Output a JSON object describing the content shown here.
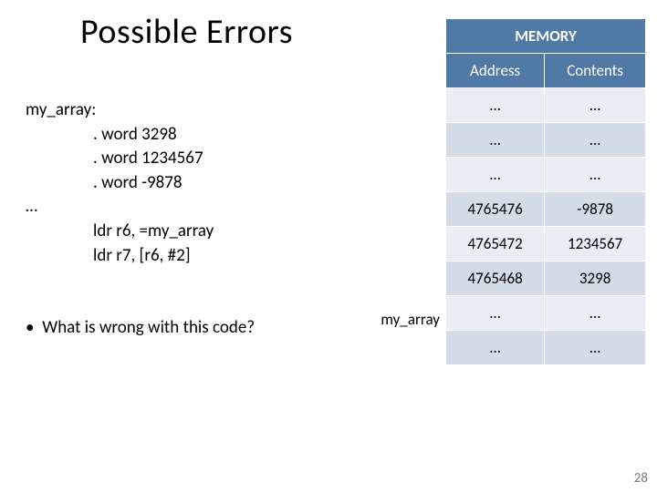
{
  "title": "Possible Errors",
  "code": {
    "label": "my_array:",
    "l1": ". word 3298",
    "l2": ". word 1234567",
    "l3": ". word -9878",
    "dots": "…",
    "l4": "ldr r6, =my_array",
    "l5": "ldr r7, [r6, #2]"
  },
  "bullet": {
    "dot": "•",
    "text": "What is wrong with this code?"
  },
  "memory": {
    "title": "MEMORY",
    "h1": "Address",
    "h2": "Contents",
    "rows": [
      {
        "a": "…",
        "c": "…"
      },
      {
        "a": "…",
        "c": "…"
      },
      {
        "a": "…",
        "c": "…"
      },
      {
        "a": "4765476",
        "c": "-9878"
      },
      {
        "a": "4765472",
        "c": "1234567"
      },
      {
        "a": "4765468",
        "c": "3298"
      },
      {
        "a": "…",
        "c": "…"
      },
      {
        "a": "…",
        "c": "…"
      }
    ],
    "row_label": "my_array"
  },
  "page": "28"
}
